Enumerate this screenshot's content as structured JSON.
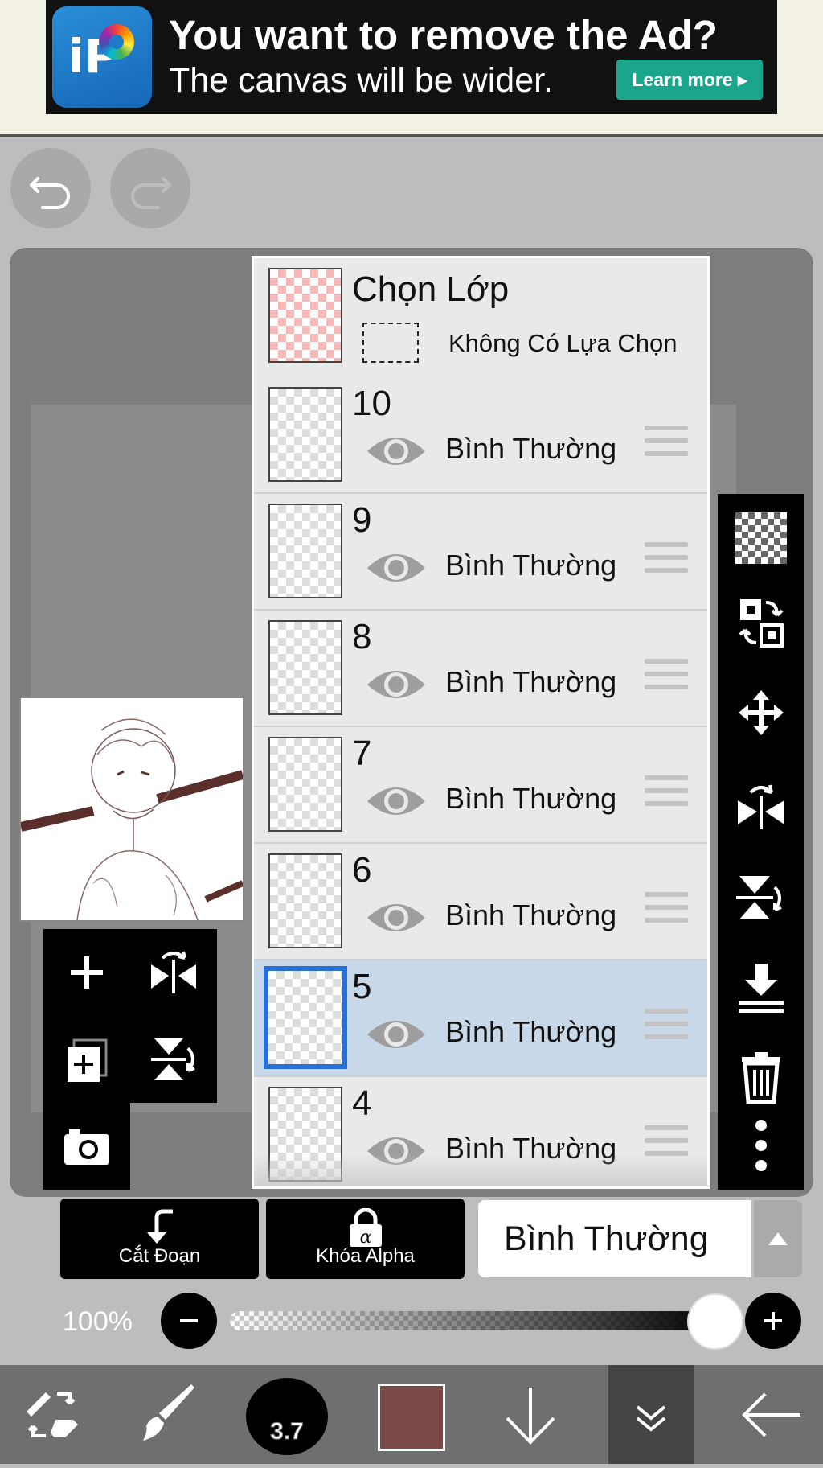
{
  "ad": {
    "title": "You want to remove the Ad?",
    "subtitle": "The canvas will be wider.",
    "learn_more": "Learn more ▸",
    "logo_letter": "iP",
    "logo_icon": "ibispaint-logo"
  },
  "toolbar_top": {
    "undo_icon": "undo-icon",
    "redo_icon": "redo-icon"
  },
  "layer_panel": {
    "selection_layer": {
      "title": "Chọn Lớp",
      "status": "Không Có Lựa Chọn"
    },
    "layers": [
      {
        "name": "10",
        "mode": "Bình Thường",
        "visible": true,
        "selected": false
      },
      {
        "name": "9",
        "mode": "Bình Thường",
        "visible": true,
        "selected": false
      },
      {
        "name": "8",
        "mode": "Bình Thường",
        "visible": true,
        "selected": false
      },
      {
        "name": "7",
        "mode": "Bình Thường",
        "visible": true,
        "selected": false
      },
      {
        "name": "6",
        "mode": "Bình Thường",
        "visible": true,
        "selected": false
      },
      {
        "name": "5",
        "mode": "Bình Thường",
        "visible": true,
        "selected": true
      },
      {
        "name": "4",
        "mode": "Bình Thường",
        "visible": true,
        "selected": false
      }
    ]
  },
  "right_tools": [
    "transparent-bg-icon",
    "swap-layer-icon",
    "move-icon",
    "flip-horizontal-icon",
    "flip-vertical-icon",
    "merge-down-icon",
    "trash-icon",
    "more-icon"
  ],
  "left_tools": [
    "add-layer-icon",
    "flip-horizontal-icon",
    "duplicate-layer-icon",
    "flip-vertical-icon",
    "camera-icon"
  ],
  "bottom_controls": {
    "clipping_label": "Cắt Đoạn",
    "alpha_lock_label": "Khóa Alpha",
    "blend_mode": "Bình Thường"
  },
  "opacity": {
    "label": "100%",
    "value": 1.0
  },
  "bottom_bar": {
    "brush_size": "3.7",
    "current_color": "#7a4a48",
    "icons": [
      "tool-switch-icon",
      "brush-icon",
      "brush-size-icon",
      "color-icon",
      "arrow-down-icon",
      "layers-icon",
      "back-arrow-icon"
    ]
  },
  "colors": {
    "selected_layer_bg": "#c9d8e8",
    "selected_border": "#2671d9",
    "ad_button": "#19a68c"
  }
}
